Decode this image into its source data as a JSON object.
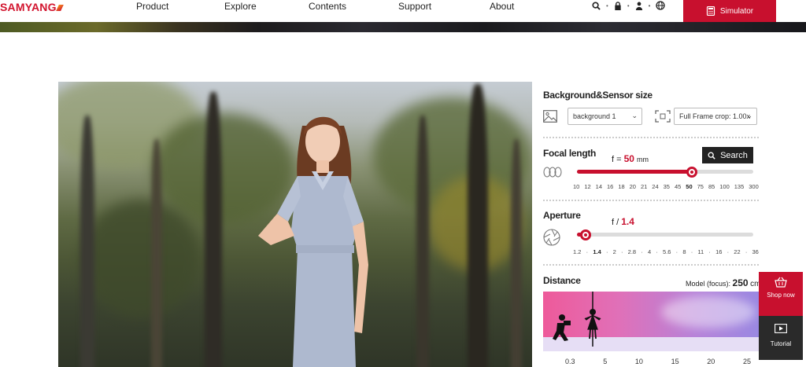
{
  "header": {
    "logo": "SAMYANG",
    "nav": [
      "Product",
      "Explore",
      "Contents",
      "Support",
      "About"
    ],
    "icons": [
      "search-icon",
      "lock-icon",
      "user-icon",
      "globe-icon"
    ],
    "simulator_label": "Simulator"
  },
  "panel": {
    "bg_title": "Background&Sensor size",
    "background_select": "background 1",
    "sensor_select": "Full Frame crop: 1.00x",
    "focal": {
      "title": "Focal length",
      "prefix": "f =",
      "value": "50",
      "unit": "mm",
      "search_label": "Search",
      "ticks": [
        "10",
        "12",
        "14",
        "16",
        "18",
        "20",
        "21",
        "24",
        "35",
        "45",
        "50",
        "75",
        "85",
        "100",
        "135",
        "300"
      ],
      "selected_index": 10,
      "level": 0.65
    },
    "aperture": {
      "title": "Aperture",
      "prefix": "f /",
      "value": "1.4",
      "ticks": [
        "1.2",
        "1.4",
        "2",
        "2.8",
        "4",
        "5.6",
        "8",
        "11",
        "16",
        "22",
        "36"
      ],
      "selected_index": 1,
      "level": 0.05
    },
    "distance": {
      "title": "Distance",
      "model_focus_label": "Model (focus):",
      "model_focus_value": "250",
      "model_focus_unit": "cm",
      "ticks": [
        "0.3",
        "5",
        "10",
        "15",
        "20",
        "25"
      ]
    }
  },
  "side": {
    "shop_label": "Shop now",
    "tutorial_label": "Tutorial"
  },
  "colors": {
    "accent": "#c8102e",
    "dark": "#222222"
  }
}
